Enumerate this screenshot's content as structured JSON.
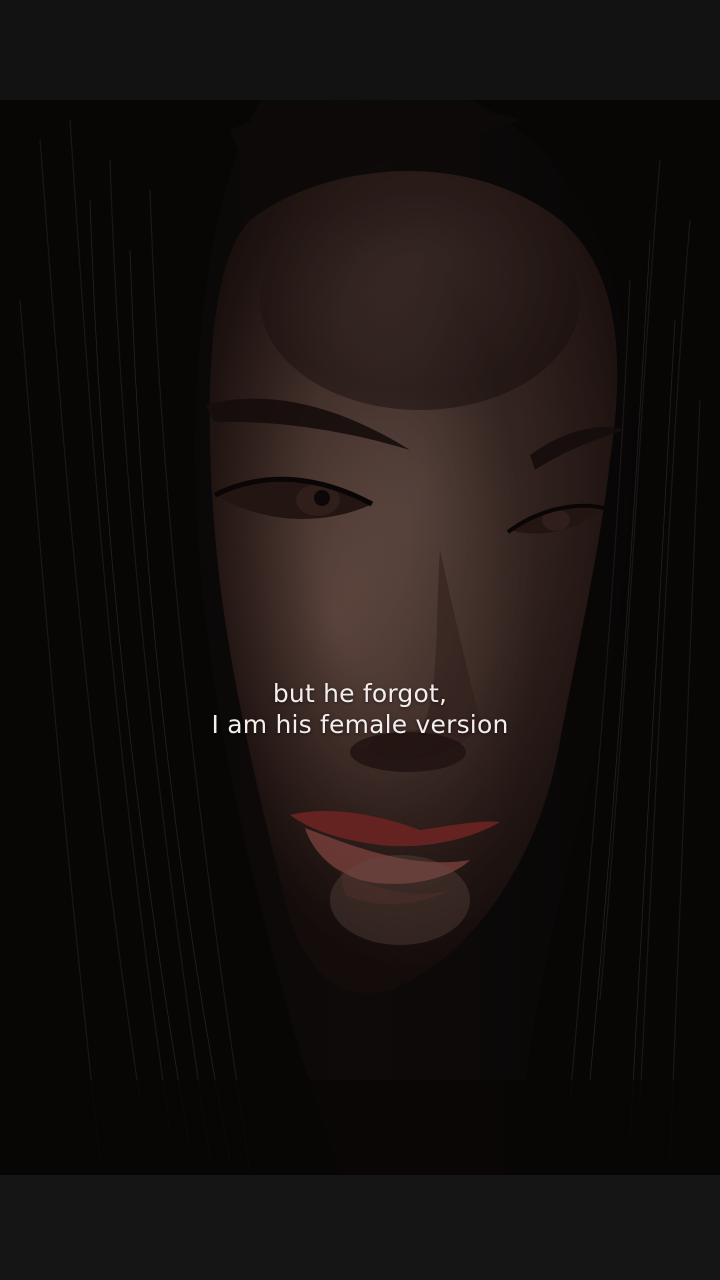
{
  "reel": {
    "caption_line1": "but he forgot,",
    "caption_line2": "I am his female version"
  },
  "colors": {
    "letterbox": "#121212",
    "caption_text": "#f2eeec",
    "skin_shadow": "#3a2622",
    "skin_light": "#8c6e64",
    "hair": "#0b0909",
    "lips": "#7a2a28"
  },
  "icons": {
    "photo": "portrait-photo"
  }
}
